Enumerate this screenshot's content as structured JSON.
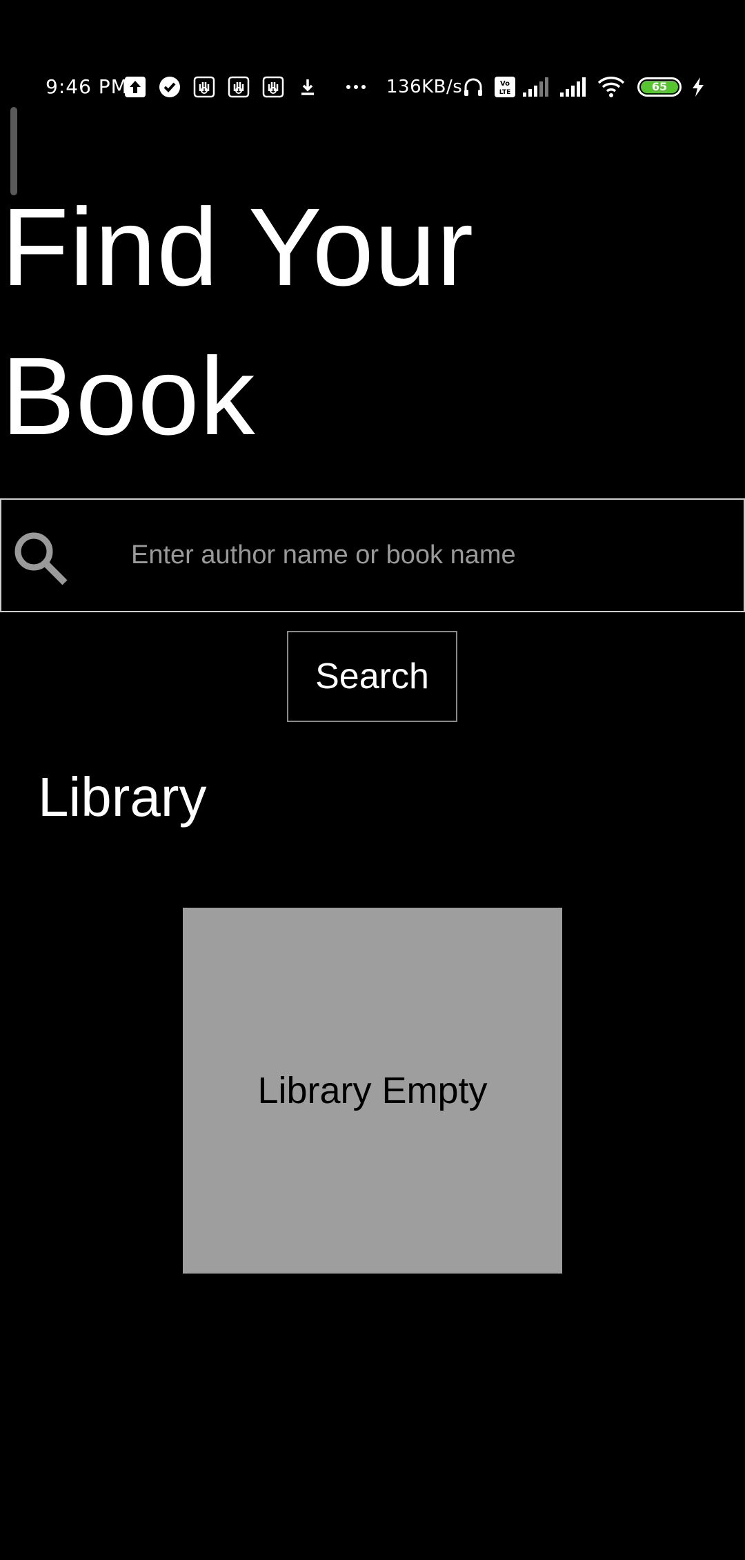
{
  "status_bar": {
    "time": "9:46 PM",
    "network_speed": "136KB/s",
    "battery_level": "65",
    "icons": [
      "upload-icon",
      "check-circle-icon",
      "hand-icon",
      "hand-icon",
      "hand-icon",
      "download-icon",
      "more-dots-icon",
      "headphones-icon",
      "volte-icon",
      "signal-icon",
      "signal-icon",
      "wifi-icon",
      "battery-icon",
      "charging-icon"
    ],
    "battery_color": "#57c532"
  },
  "header": {
    "title": "Find Your Book"
  },
  "search": {
    "placeholder": "Enter author name or book name",
    "value": "",
    "button_label": "Search"
  },
  "library": {
    "heading": "Library",
    "empty_message": "Library Empty",
    "empty_box_color": "#9e9e9e"
  },
  "colors": {
    "background": "#000000",
    "text": "#ffffff",
    "placeholder": "#9a9a9a"
  }
}
